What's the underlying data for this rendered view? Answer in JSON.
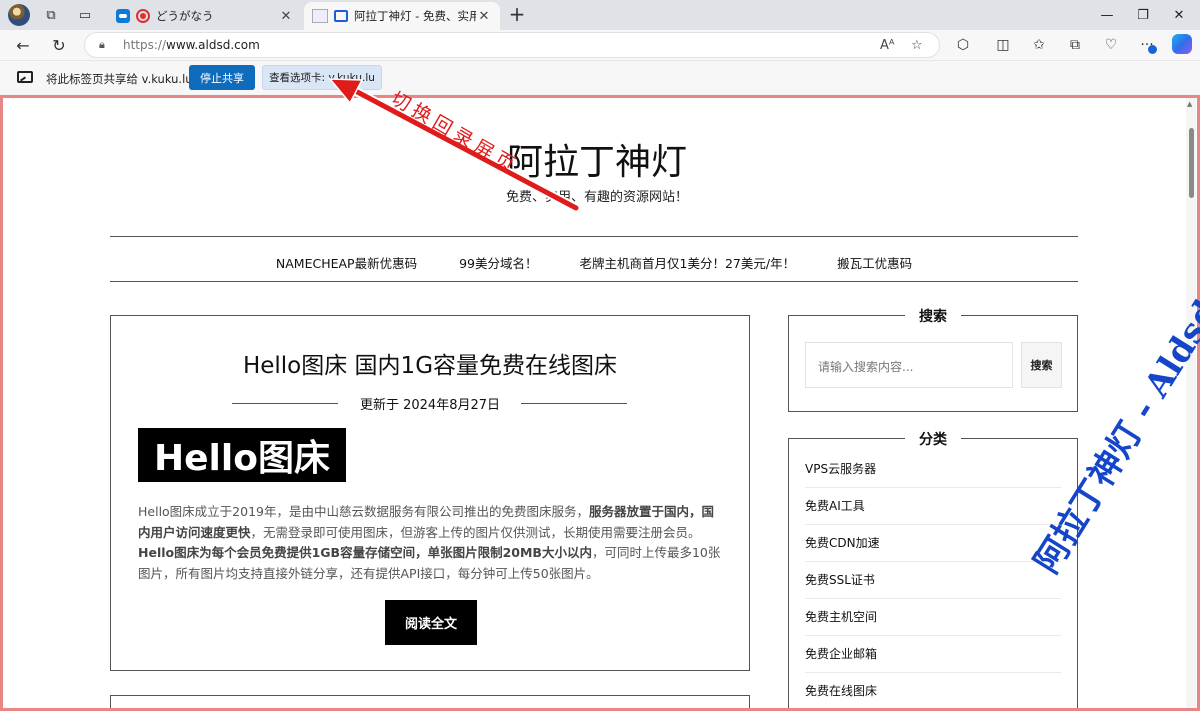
{
  "browser": {
    "tabs": [
      {
        "title": "どうがなう",
        "active": false
      },
      {
        "title": "阿拉丁神灯 - 免费、实用、有趣的资源网站",
        "active": true
      }
    ],
    "address": {
      "protocol": "https://",
      "host": "www.aldsd.com"
    },
    "icons": [
      "back-icon",
      "refresh-icon",
      "lock-icon",
      "read-aloud-icon",
      "favorite-icon",
      "extensions-icon",
      "split-screen-icon",
      "favorites-icon",
      "collections-icon",
      "browser-essentials-icon",
      "more-icon",
      "copilot-icon"
    ]
  },
  "sharebar": {
    "message": "将此标签页共享给 v.kuku.lu",
    "stop_label": "停止共享",
    "view_label": "查看选项卡: v.kuku.lu"
  },
  "site": {
    "title": "阿拉丁神灯",
    "subtitle": "免费、实用、有趣的资源网站！",
    "menu": [
      "NAMECHEAP最新优惠码",
      "99美分域名！",
      "老牌主机商首月仅1美分！27美元/年！",
      "搬瓦工优惠码"
    ]
  },
  "post": {
    "title": "Hello图床 国内1G容量免费在线图床",
    "date": "更新于 2024年8月27日",
    "image_text": "Hello图床",
    "excerpt_parts": [
      {
        "text": "Hello图床成立于2019年，是由中山慈云数据服务有限公司推出的免费图床服务，",
        "bold": false
      },
      {
        "text": "服务器放置于国内，国内用户访问速度更快",
        "bold": true
      },
      {
        "text": "，无需登录即可使用图床，但游客上传的图片仅供测试，长期使用需要注册会员。",
        "bold": false
      },
      {
        "text": "Hello图床为每个会员免费提供1GB容量存储空间，单张图片限制20MB大小以内",
        "bold": true
      },
      {
        "text": "，可同时上传最多10张图片，所有图片均支持直接外链分享，还有提供API接口，每分钟可上传50张图片。",
        "bold": false
      }
    ],
    "read_more": "阅读全文"
  },
  "sidebar": {
    "search": {
      "title": "搜索",
      "placeholder": "请输入搜索内容...",
      "button": "搜索"
    },
    "categories": {
      "title": "分类",
      "items": [
        "VPS云服务器",
        "免费AI工具",
        "免费CDN加速",
        "免费SSL证书",
        "免费主机空间",
        "免费企业邮箱",
        "免费在线图床"
      ]
    }
  },
  "annotations": {
    "callout": "切换回录屏页",
    "watermark": "阿拉丁神灯 - Aldsd.com",
    "arrow_color": "#e01b1b",
    "watermark_color": "#1546c9"
  }
}
